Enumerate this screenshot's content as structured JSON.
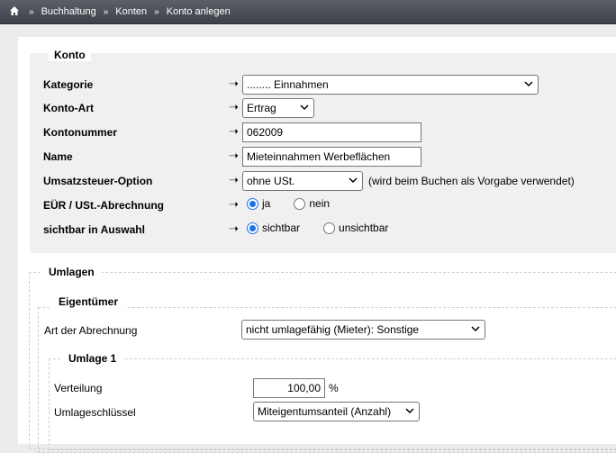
{
  "breadcrumb": {
    "items": [
      "Buchhaltung",
      "Konten",
      "Konto anlegen"
    ],
    "separator": "»"
  },
  "konto": {
    "legend": "Konto",
    "arrow": "➝",
    "kategorie": {
      "label": "Kategorie",
      "value": "........ Einnahmen"
    },
    "konto_art": {
      "label": "Konto-Art",
      "value": "Ertrag"
    },
    "kontonummer": {
      "label": "Kontonummer",
      "value": "062009"
    },
    "name": {
      "label": "Name",
      "value": "Mieteinnahmen Werbeflächen"
    },
    "umsatzsteuer": {
      "label": "Umsatzsteuer-Option",
      "value": "ohne USt.",
      "hint": "(wird beim Buchen als Vorgabe verwendet)"
    },
    "eur": {
      "label": "EÜR / USt.-Abrechnung",
      "options": [
        "ja",
        "nein"
      ],
      "selected": "ja"
    },
    "sichtbar": {
      "label": "sichtbar in Auswahl",
      "options": [
        "sichtbar",
        "unsichtbar"
      ],
      "selected": "sichtbar"
    }
  },
  "umlagen": {
    "legend": "Umlagen",
    "eigentuemer": {
      "legend": "Eigentümer",
      "art_label": "Art der Abrechnung",
      "art_value": "nicht umlagefähig (Mieter): Sonstige"
    },
    "umlage1": {
      "legend": "Umlage 1",
      "verteilung_label": "Verteilung",
      "verteilung_value": "100,00",
      "verteilung_unit": "%",
      "schluessel_label": "Umlageschlüssel",
      "schluessel_value": "Miteigentumsanteil (Anzahl)"
    }
  },
  "colors": {
    "accent": "#1a73e8",
    "topbar": "#4a4e55"
  }
}
